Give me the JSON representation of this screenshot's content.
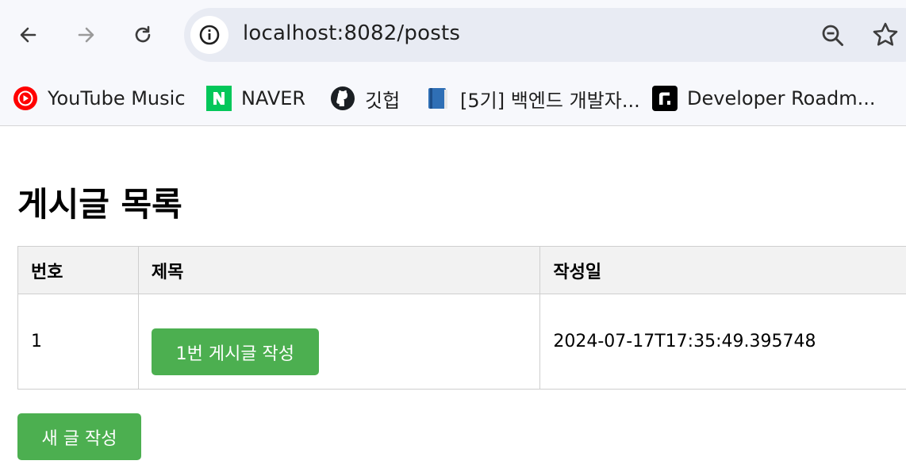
{
  "browser": {
    "url": "localhost:8082/posts",
    "bookmarks": [
      {
        "label": "YouTube Music",
        "icon": "youtube-music-icon"
      },
      {
        "label": "NAVER",
        "icon": "naver-icon"
      },
      {
        "label": "깃헙",
        "icon": "github-icon"
      },
      {
        "label": "[5기] 백엔드 개발자...",
        "icon": "book-icon"
      },
      {
        "label": "Developer Roadm...",
        "icon": "roadmap-icon"
      }
    ]
  },
  "page": {
    "title": "게시글 목록",
    "table": {
      "headers": [
        "번호",
        "제목",
        "작성일"
      ],
      "rows": [
        {
          "id": "1",
          "title": "1번 게시글 작성",
          "created_at": "2024-07-17T17:35:49.395748"
        }
      ]
    },
    "new_post_label": "새 글 작성"
  },
  "colors": {
    "accent_green": "#4caf50",
    "header_bg": "#f2f2f2",
    "chrome_bg": "#f7f8fc",
    "omnibox_bg": "#e8ebf3"
  }
}
